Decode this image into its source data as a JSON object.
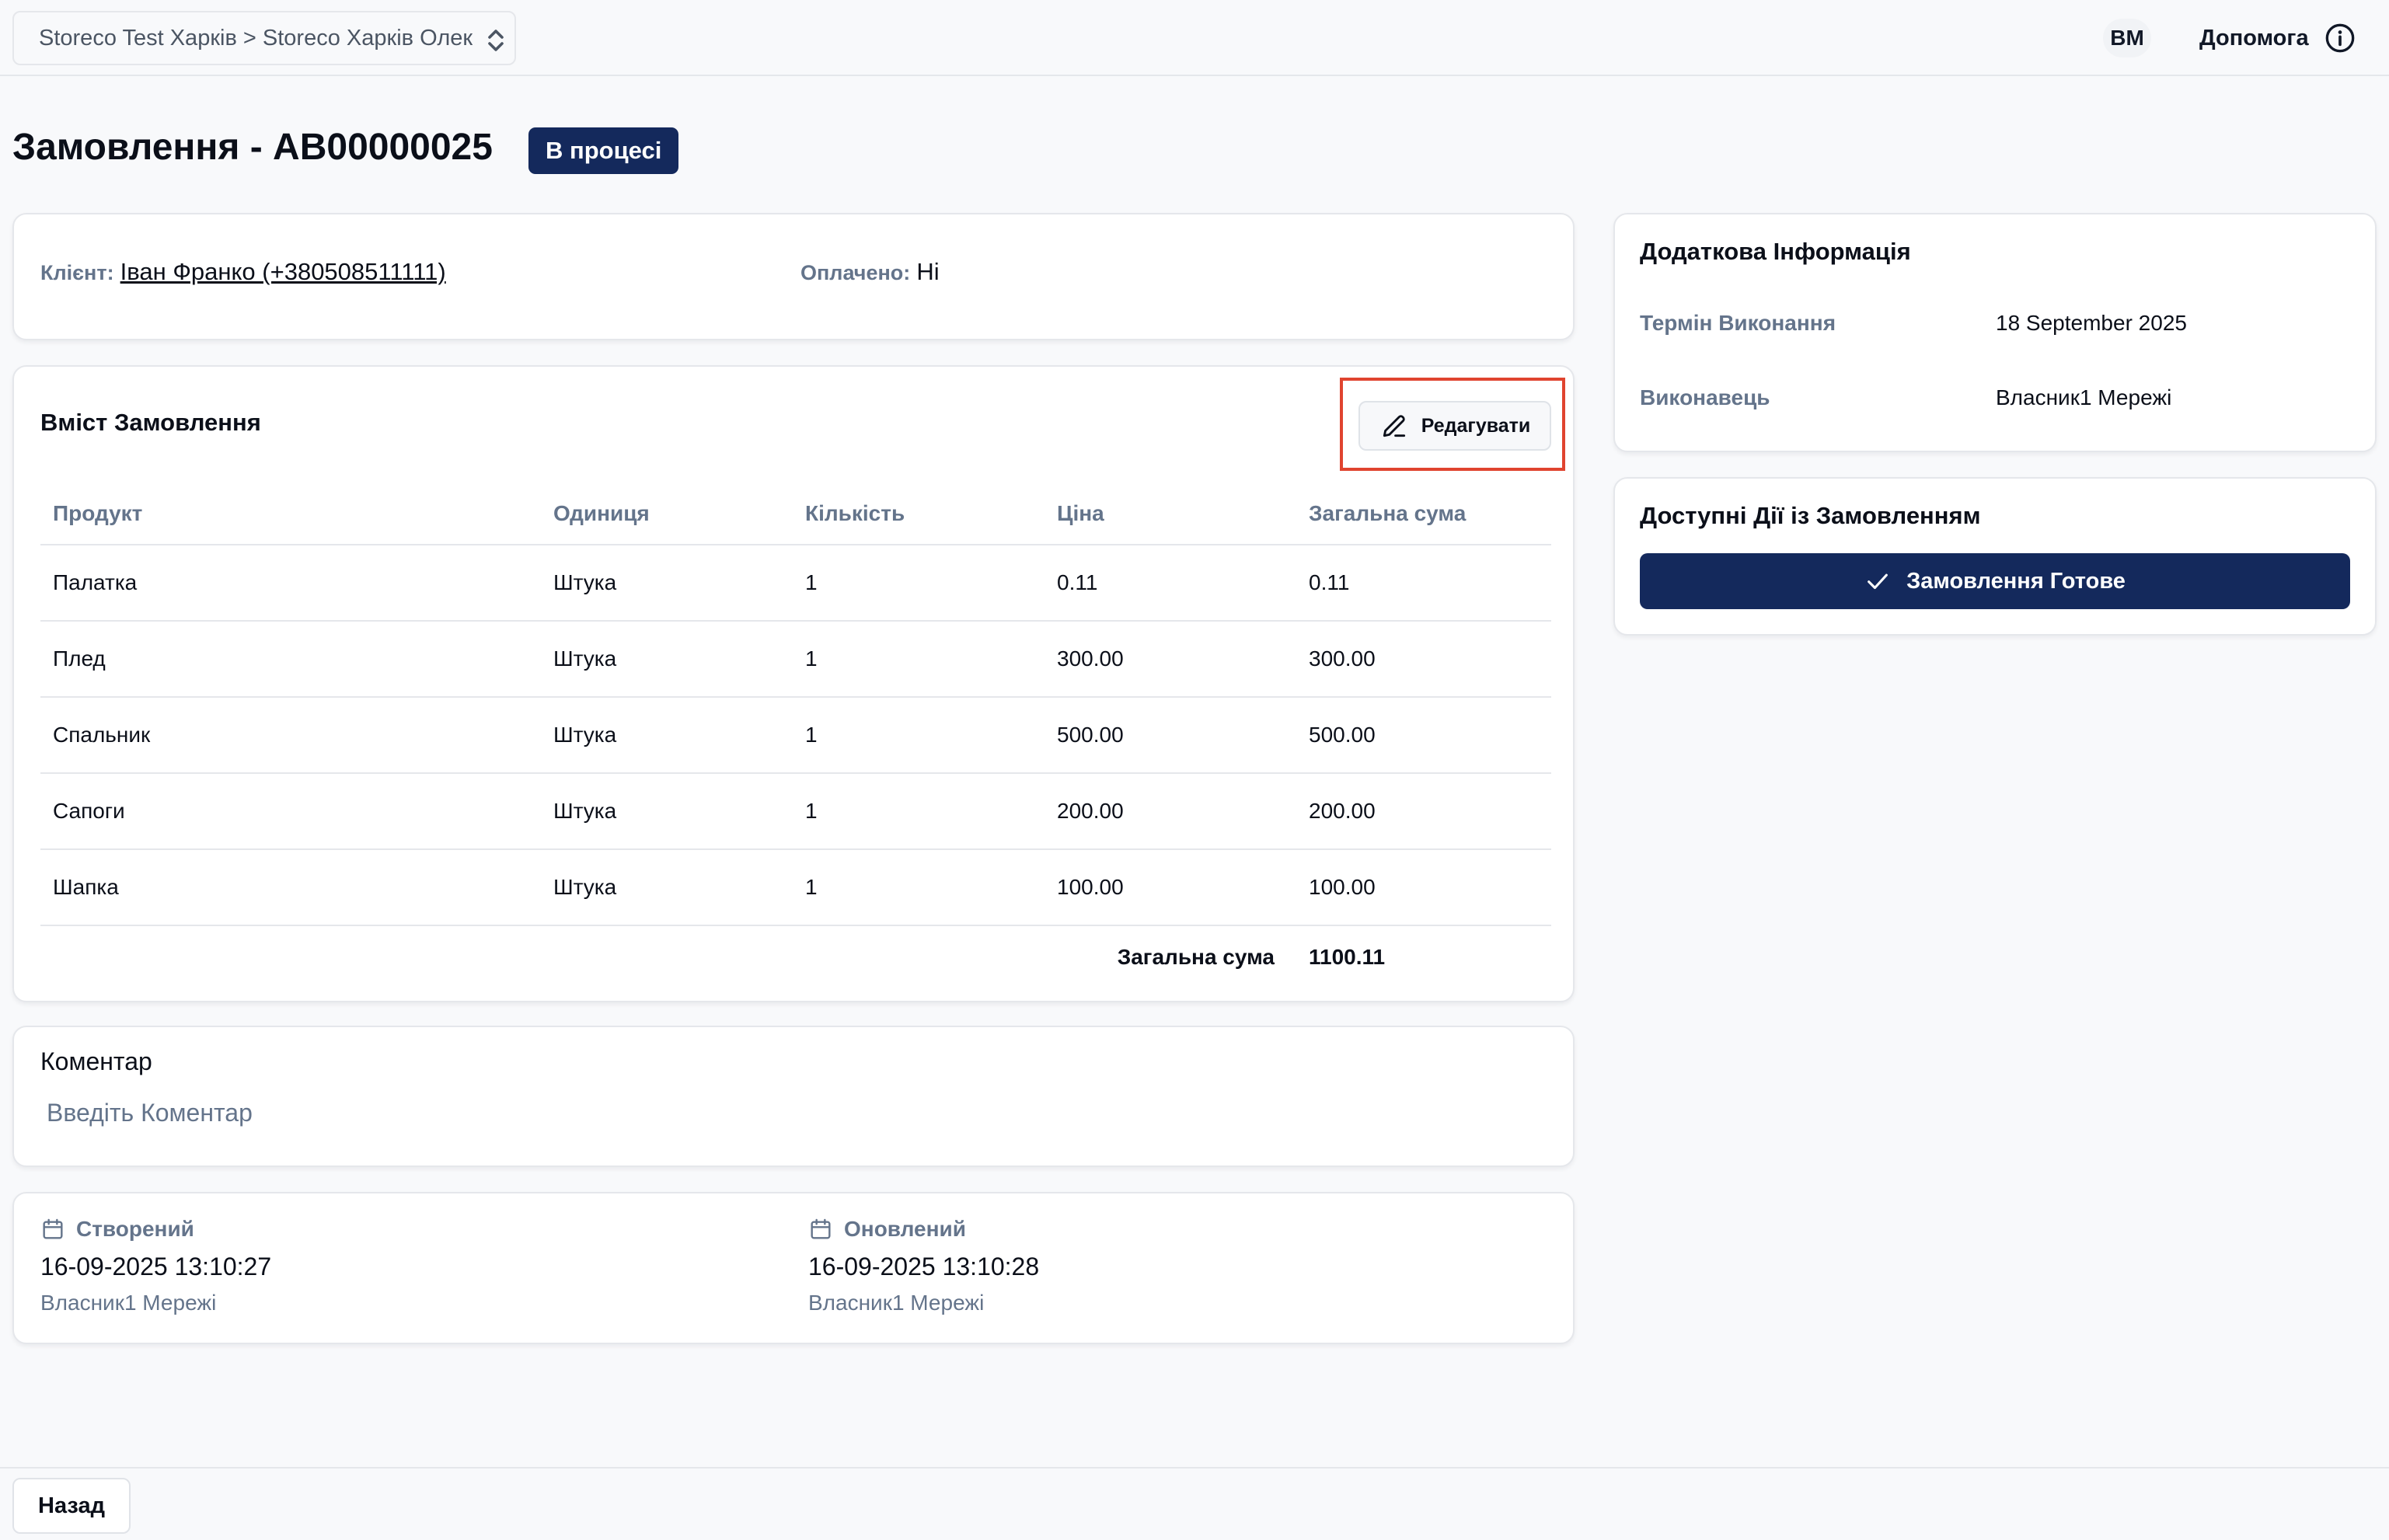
{
  "header": {
    "store_selector": "Storeco Test Харків > Storeco Харків Олек",
    "avatar_initials": "ВМ",
    "help_label": "Допомога"
  },
  "order": {
    "title": "Замовлення - AB00000025",
    "status": "В процесі"
  },
  "client": {
    "label": "Клієнт:",
    "value": "Іван Франко (+380508511111)",
    "paid_label": "Оплачено:",
    "paid_value": "Ні"
  },
  "content": {
    "title": "Вміст Замовлення",
    "edit_label": "Редагувати",
    "columns": [
      "Продукт",
      "Одиниця",
      "Кількість",
      "Ціна",
      "Загальна сума"
    ],
    "rows": [
      [
        "Палатка",
        "Штука",
        "1",
        "0.11",
        "0.11"
      ],
      [
        "Плед",
        "Штука",
        "1",
        "300.00",
        "300.00"
      ],
      [
        "Спальник",
        "Штука",
        "1",
        "500.00",
        "500.00"
      ],
      [
        "Сапоги",
        "Штука",
        "1",
        "200.00",
        "200.00"
      ],
      [
        "Шапка",
        "Штука",
        "1",
        "100.00",
        "100.00"
      ]
    ],
    "total_label": "Загальна сума",
    "total_value": "1100.11"
  },
  "comment": {
    "title": "Коментар",
    "placeholder": "Введіть Коментар"
  },
  "meta": {
    "created_label": "Створений",
    "created_date": "16-09-2025 13:10:27",
    "created_by": "Власник1 Мережі",
    "updated_label": "Оновлений",
    "updated_date": "16-09-2025 13:10:28",
    "updated_by": "Власник1 Мережі"
  },
  "info": {
    "title": "Додаткова Інформація",
    "deadline_label": "Термін Виконання",
    "deadline_value": "18 September 2025",
    "executor_label": "Виконавець",
    "executor_value": "Власник1 Мережі"
  },
  "actions": {
    "title": "Доступні Дії із Замовленням",
    "ready_label": "Замовлення Готове"
  },
  "footer": {
    "back_label": "Назад"
  },
  "colors": {
    "primary": "#14295c",
    "highlight": "#e0442f",
    "muted": "#64748b"
  }
}
